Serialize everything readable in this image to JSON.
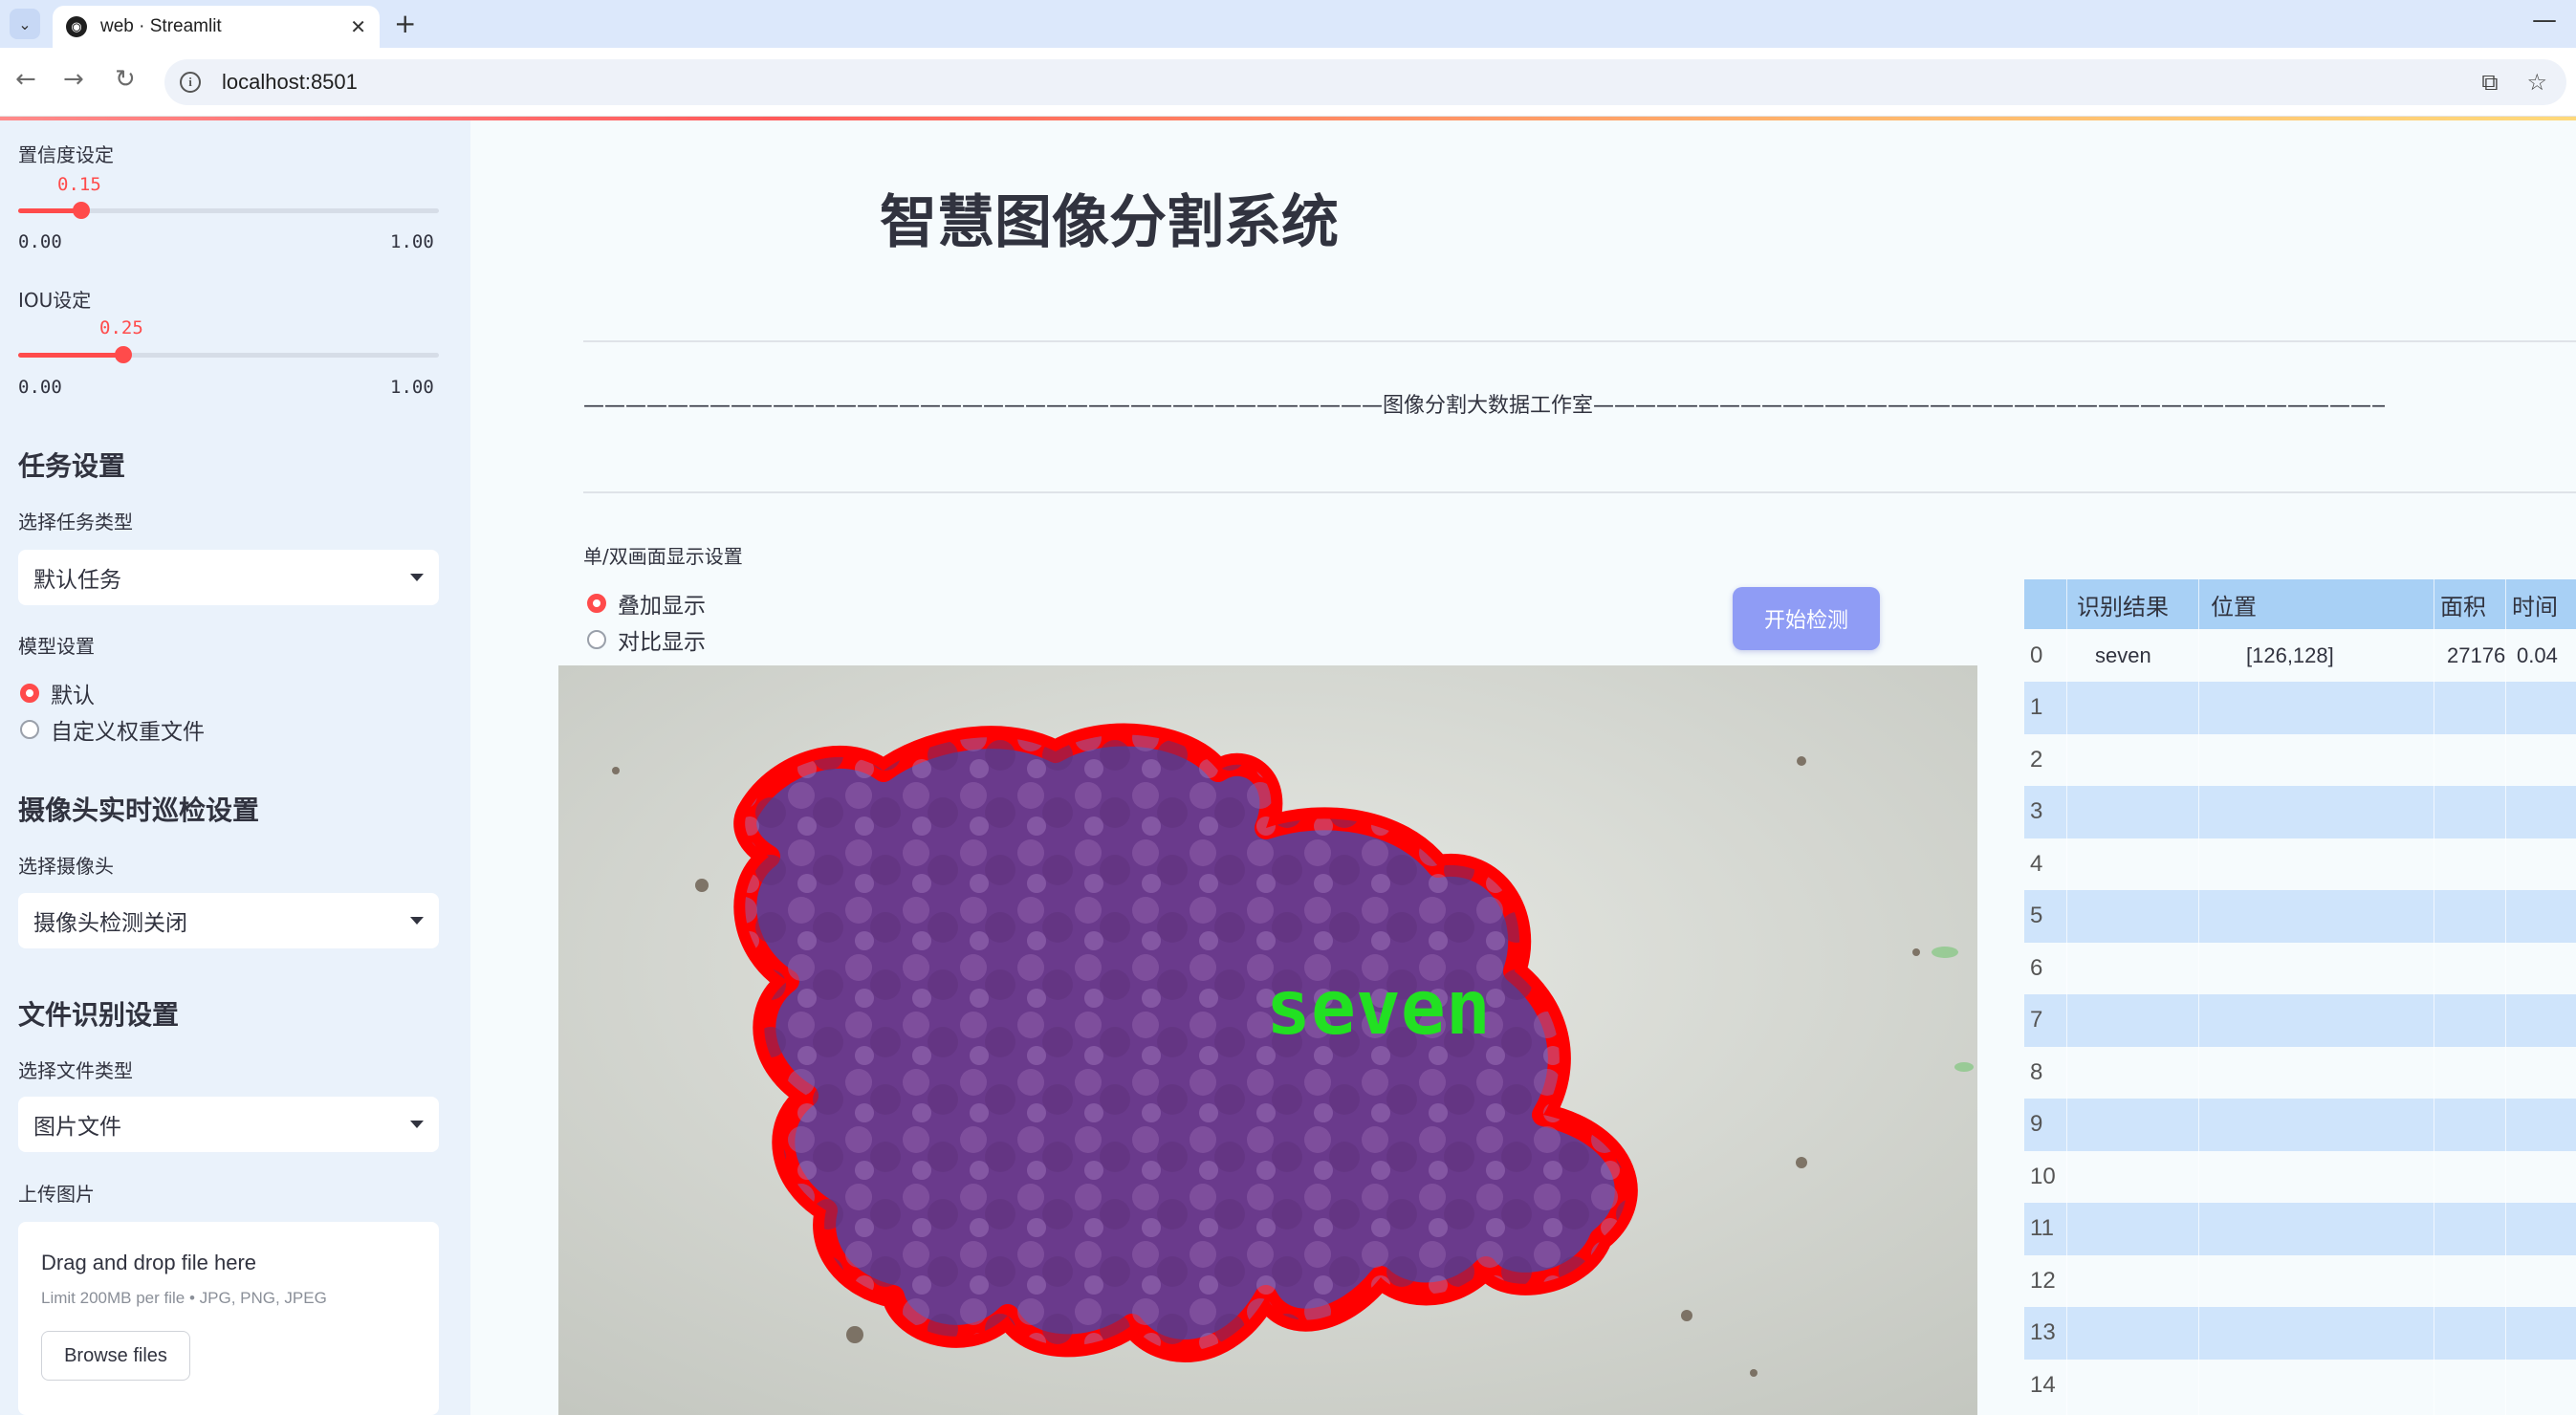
{
  "browser": {
    "tab_title": "web · Streamlit",
    "url": "localhost:8501"
  },
  "sidebar": {
    "confidence": {
      "label": "置信度设定",
      "value": "0.15",
      "min": "0.00",
      "max": "1.00",
      "fraction": 0.15
    },
    "iou": {
      "label": "IOU设定",
      "value": "0.25",
      "min": "0.00",
      "max": "1.00",
      "fraction": 0.25
    },
    "task_section": {
      "title": "任务设置",
      "select_label": "选择任务类型",
      "select_value": "默认任务"
    },
    "model_section": {
      "label": "模型设置",
      "options": [
        "默认",
        "自定义权重文件"
      ],
      "selected": 0
    },
    "camera_section": {
      "title": "摄像头实时巡检设置",
      "select_label": "选择摄像头",
      "select_value": "摄像头检测关闭"
    },
    "file_section": {
      "title": "文件识别设置",
      "select_label": "选择文件类型",
      "select_value": "图片文件",
      "upload_label": "上传图片"
    },
    "uploader": {
      "title": "Drag and drop file here",
      "subtitle": "Limit 200MB per file • JPG, PNG, JPEG",
      "button": "Browse files"
    }
  },
  "main": {
    "title": "智慧图像分割系统",
    "studio_line": "——————————————————————————————————————图像分割大数据工作室——————————————————————————————————————————",
    "display_label": "单/双画面显示设置",
    "display_options": [
      "叠加显示",
      "对比显示"
    ],
    "display_selected": 0,
    "detect_button": "开始检测",
    "overlay_label": "seven"
  },
  "table": {
    "headers": [
      "识别结果",
      "位置",
      "面积",
      "时间"
    ],
    "rows": [
      {
        "index": "0",
        "result": "seven",
        "position": "[126,128]",
        "area": "27176",
        "time": "0.04"
      },
      {
        "index": "1"
      },
      {
        "index": "2"
      },
      {
        "index": "3"
      },
      {
        "index": "4"
      },
      {
        "index": "5"
      },
      {
        "index": "6"
      },
      {
        "index": "7"
      },
      {
        "index": "8"
      },
      {
        "index": "9"
      },
      {
        "index": "10"
      },
      {
        "index": "11"
      },
      {
        "index": "12"
      },
      {
        "index": "13"
      },
      {
        "index": "14"
      }
    ]
  },
  "colors": {
    "accent": "#ff4b4b",
    "sidebar_bg": "#eaf2fb",
    "main_bg": "#f6fbfd",
    "button_bg": "#8f9cf5",
    "table_header": "#a8d0f5",
    "table_alt": "#cfe4fb",
    "mask_fill": "#7a3f96",
    "mask_outline": "#ff0000",
    "label_text": "#22e022"
  }
}
